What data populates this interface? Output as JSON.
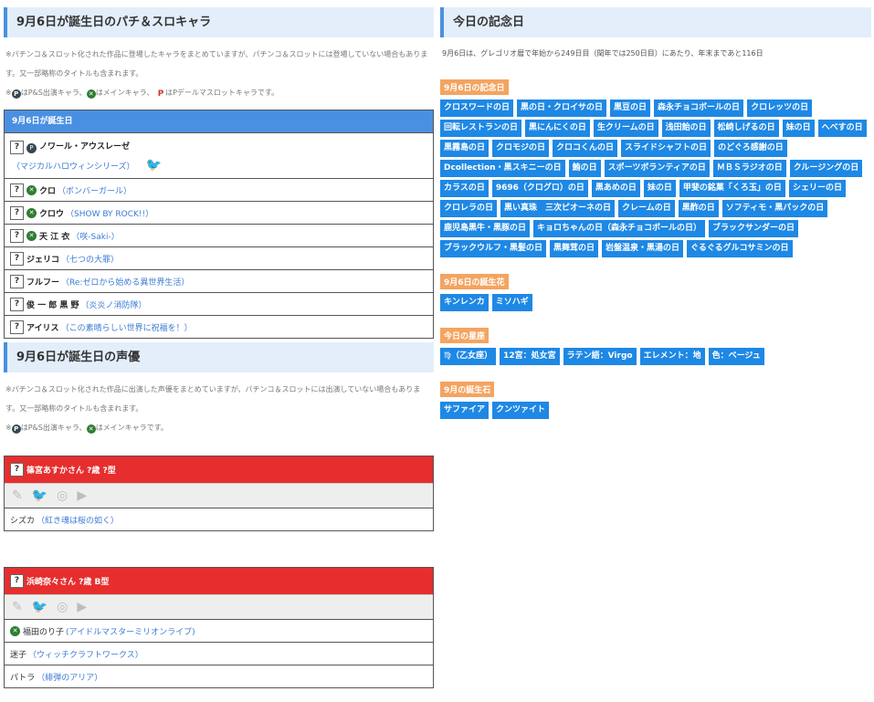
{
  "chara_section": {
    "title": "9月6日が誕生日のパチ＆スロキャラ",
    "note1": "※パチンコ＆スロット化された作品に登場したキャラをまとめていますが、パチンコ＆スロットには登場していない場合もあります。又一部略称のタイトルも含まれます。",
    "note2_a": "はP&S出演キャラ、",
    "note2_b": "はメインキャラ、",
    "note2_c": "はPデールマスロットキャラです。",
    "box_title": "9月6日が誕生日",
    "rows": [
      {
        "name": "ノワール・アウスレーゼ",
        "work": "（マジカルハロウィンシリーズ）"
      },
      {
        "name": "クロ",
        "work": "（ボンバーガール）"
      },
      {
        "name": "クロウ",
        "work": "（SHOW BY ROCK!!）"
      },
      {
        "name": "天 江 衣",
        "work": "（咲-Saki-）"
      },
      {
        "name": "ジェリコ",
        "work": "（七つの大罪）"
      },
      {
        "name": "フルフー",
        "work": "（Re:ゼロから始める異世界生活）"
      },
      {
        "name": "俊 一 郎 黒 野",
        "work": "（炎炎ノ消防隊）"
      },
      {
        "name": "アイリス",
        "work": "（この素晴らしい世界に祝福を！）"
      }
    ]
  },
  "voice_section": {
    "title": "9月6日が誕生日の声優",
    "note1": "※パチンコ＆スロット化された作品に出演した声優をまとめていますが、パチンコ＆スロットには出演していない場合もあります。又一部略称のタイトルも含まれます。",
    "note2_a": "はP&S出演キャラ、",
    "note2_b": "はメインキャラです。",
    "cards": [
      {
        "head": "篠宮あすかさん ?歳 ?型",
        "roles": [
          {
            "name": "シズカ",
            "work": "（紅き魂は桜の如く）"
          }
        ]
      },
      {
        "head": "浜崎奈々さん ?歳 B型",
        "roles": [
          {
            "name": "福田のり子",
            "work": "(アイドルマスターミリオンライブ)"
          },
          {
            "name": "迷子",
            "work": "（ウィッチクラフトワークス）"
          },
          {
            "name": "パトラ",
            "work": "（緋弾のアリア）"
          }
        ]
      }
    ]
  },
  "anniv": {
    "title": "今日の記念日",
    "intro": "9月6日は、グレゴリオ暦で年始から249日目（閏年では250日目）にあたり、年末まであと116日",
    "kinenbi_label": "9月6日の記念日",
    "kinenbi": [
      "クロスワードの日",
      "黒の日・クロイサの日",
      "黒豆の日",
      "森永チョコボールの日",
      "クロレッツの日",
      "回転レストランの日",
      "黒にんにくの日",
      "生クリームの日",
      "浅田飴の日",
      "松崎しげるの日",
      "妹の日",
      "へべすの日",
      "黒霧島の日",
      "クロモジの日",
      "クロコくんの日",
      "スライドシャフトの日",
      "のどぐろ感謝の日",
      "Dcollection・黒スキニーの日",
      "鮪の日",
      "スポーツボランティアの日",
      "ＭＢＳラジオの日",
      "クルージングの日",
      "カラスの日",
      "9696（クログロ）の日",
      "黒あめの日",
      "妹の日",
      "甲斐の銘菓「くろ玉」の日",
      "シェリーの日",
      "クロレラの日",
      "黒い真珠　三次ピオーネの日",
      "クレームの日",
      "黒酢の日",
      "ソフティモ・黒パックの日",
      "鹿児島黒牛・黒豚の日",
      "キョロちゃんの日（森永チョコボールの日）",
      "ブラックサンダーの日",
      "ブラックウルフ・黒髪の日",
      "黒舞茸の日",
      "岩盤温泉・黒湯の日",
      "ぐるぐるグルコサミンの日"
    ],
    "flower_label": "9月6日の誕生花",
    "flowers": [
      "キンレンカ",
      "ミソハギ"
    ],
    "zodiac_label": "今日の星座",
    "zodiac": [
      "♍（乙女座）",
      "12宮：処女宮",
      "ラテン語：Virgo",
      "エレメント：地",
      "色：ベージュ"
    ],
    "stone_label": "9月の誕生石",
    "stones": [
      "サファイア",
      "クンツァイト"
    ]
  }
}
